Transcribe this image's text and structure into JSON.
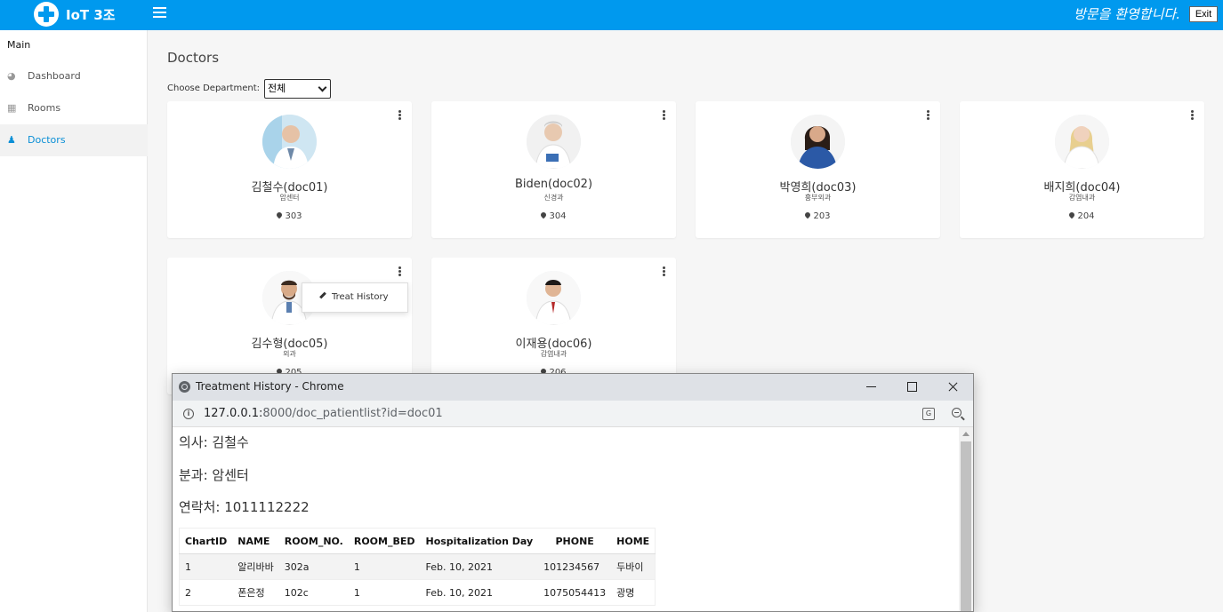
{
  "header": {
    "brand": "IoT 3조",
    "welcome": "방문을 환영합니다.",
    "exit_label": "Exit"
  },
  "sidebar": {
    "heading": "Main",
    "items": [
      {
        "label": "Dashboard",
        "icon": "dashboard-icon"
      },
      {
        "label": "Rooms",
        "icon": "building-icon"
      },
      {
        "label": "Doctors",
        "icon": "user-md-icon",
        "active": true
      }
    ]
  },
  "main": {
    "title": "Doctors",
    "dept_label": "Choose Department:",
    "dept_selected": "전체",
    "popup_label": "Treat History"
  },
  "doctors": [
    {
      "name": "김철수(doc01)",
      "dept": "암센터",
      "room": "303"
    },
    {
      "name": "Biden(doc02)",
      "dept": "신경과",
      "room": "304"
    },
    {
      "name": "박영희(doc03)",
      "dept": "흉부외과",
      "room": "203"
    },
    {
      "name": "배지희(doc04)",
      "dept": "감염내과",
      "room": "204"
    },
    {
      "name": "김수형(doc05)",
      "dept": "외과",
      "room": "205"
    },
    {
      "name": "이재용(doc06)",
      "dept": "감염내과",
      "room": "206"
    }
  ],
  "window": {
    "title": "Treatment History - Chrome",
    "url_host": "127.0.0.1:",
    "url_rest": "8000/doc_patientlist?id=doc01",
    "doctor_line": "의사: 김철수",
    "dept_line": "분과: 암센터",
    "contact_line": "연락처: 1011112222",
    "table": {
      "headers": [
        "ChartID",
        "NAME",
        "ROOM_NO.",
        "ROOM_BED",
        "Hospitalization Day",
        "PHONE",
        "HOME"
      ],
      "rows": [
        [
          "1",
          "알리바바",
          "302a",
          "1",
          "Feb. 10, 2021",
          "101234567",
          "두바이"
        ],
        [
          "2",
          "폰은정",
          "102c",
          "1",
          "Feb. 10, 2021",
          "1075054413",
          "광명"
        ]
      ]
    }
  },
  "colors": {
    "accent": "#0099ee",
    "active_link": "#0a8fd6"
  }
}
